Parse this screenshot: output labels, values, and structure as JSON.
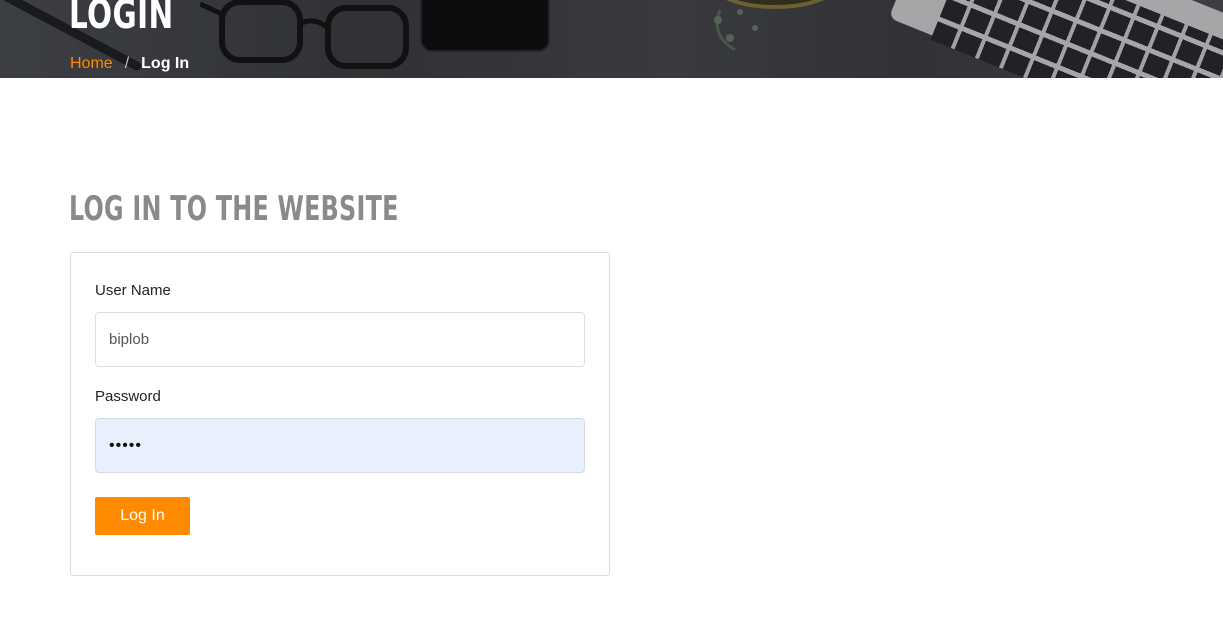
{
  "banner": {
    "title": "LOGIN",
    "breadcrumb": {
      "home": "Home",
      "separator": "/",
      "current": "Log In"
    }
  },
  "main": {
    "section_title": "LOG IN TO THE WEBSITE",
    "form": {
      "username_label": "User Name",
      "username_value": "biplob",
      "password_label": "Password",
      "password_value": "abcde",
      "submit_label": "Log In"
    }
  },
  "colors": {
    "accent": "#ff8a00",
    "autofill_bg": "#e8f0fe",
    "section_title": "#8a8a8a"
  }
}
